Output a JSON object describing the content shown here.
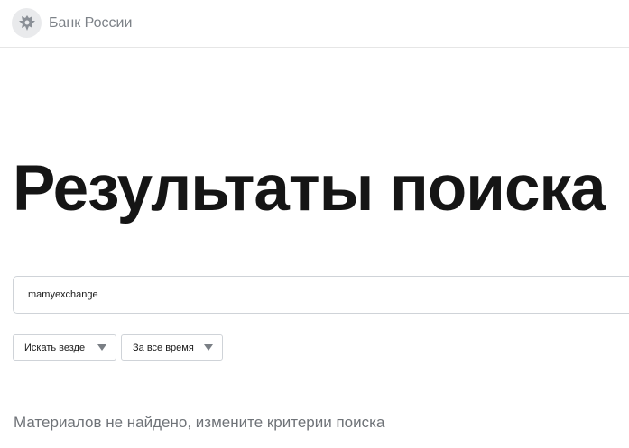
{
  "header": {
    "logo_text": "Банк России",
    "logo_icon": "eagle-emblem-icon"
  },
  "main": {
    "title": "Результаты поиска",
    "search": {
      "value": "mamyexchange"
    },
    "filters": [
      {
        "label": "Искать везде",
        "icon": "chevron-down-icon"
      },
      {
        "label": "За все время",
        "icon": "chevron-down-icon"
      }
    ],
    "no_results_message": "Материалов не найдено, измените критерии поиска"
  },
  "colors": {
    "title": "#151515",
    "muted_text": "#6f7378",
    "border": "#cfd3d8",
    "logo_text": "#7d8288"
  }
}
